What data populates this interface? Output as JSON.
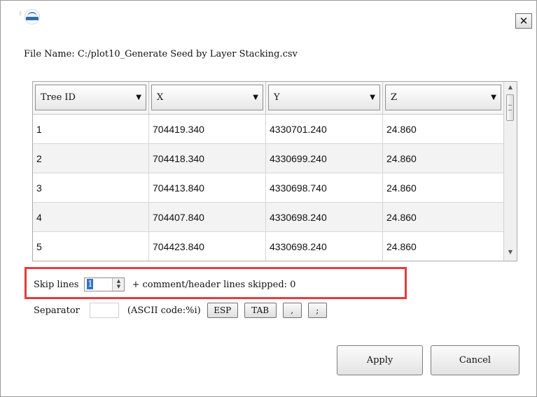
{
  "window": {
    "close_glyph": "✕",
    "logo_icon": "lidar-app-logo-icon"
  },
  "file": {
    "label": "File Name:",
    "path": "C:/plot10_Generate Seed by Layer Stacking.csv"
  },
  "table": {
    "columns": [
      "Tree ID",
      "X",
      "Y",
      "Z"
    ],
    "rows": [
      [
        "1",
        "704419.340",
        "4330701.240",
        "24.860"
      ],
      [
        "2",
        "704418.340",
        "4330699.240",
        "24.860"
      ],
      [
        "3",
        "704413.840",
        "4330698.740",
        "24.860"
      ],
      [
        "4",
        "704407.840",
        "4330698.240",
        "24.860"
      ],
      [
        "5",
        "704423.840",
        "4330698.240",
        "24.860"
      ]
    ]
  },
  "skip": {
    "label": "Skip lines",
    "value": "1",
    "suffix": "+ comment/header lines skipped: 0"
  },
  "separator": {
    "label": "Separator",
    "value": "",
    "hint": "(ASCII code:%i)",
    "buttons": [
      "ESP",
      "TAB",
      ",",
      ";"
    ]
  },
  "actions": {
    "apply": "Apply",
    "cancel": "Cancel"
  },
  "colors": {
    "highlight": "#e53c3c",
    "selection": "#3472c6"
  }
}
